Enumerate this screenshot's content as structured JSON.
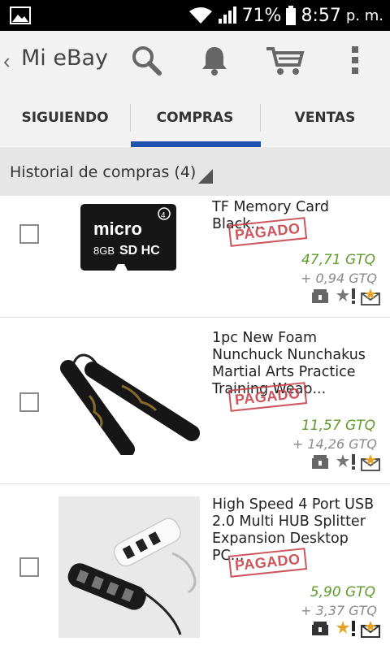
{
  "status_bar": {
    "battery": "71%",
    "time": "8:57",
    "ampm": "p. m."
  },
  "action_bar": {
    "back_chevron": "‹",
    "title": "Mi eBay"
  },
  "tabs": [
    {
      "label": "SIGUIENDO",
      "selected": false
    },
    {
      "label": "COMPRAS",
      "selected": true
    },
    {
      "label": "VENTAS",
      "selected": false
    }
  ],
  "section": {
    "title": "Historial de compras (4)"
  },
  "colors": {
    "accent": "#1f50b0",
    "paid_stamp": "#c8434b",
    "price": "#5f9a2a"
  },
  "items": [
    {
      "title": "TF Memory Card Black...",
      "status": "PAGADO",
      "price": "47,71 GTQ",
      "shipping": "+ 0,94 GTQ",
      "checked": false,
      "product_icon": "micro-sd-card-image",
      "card_text": "micro",
      "card_sub": "SD HC",
      "card_size": "8GB",
      "card_class": "4"
    },
    {
      "title": "1pc New Foam Nunchuck Nunchakus Martial Arts Practice Training Weap...",
      "status": "PAGADO",
      "price": "11,57 GTQ",
      "shipping": "+ 14,26 GTQ",
      "checked": false,
      "product_icon": "nunchaku-image"
    },
    {
      "title": "High Speed 4 Port USB 2.0 Multi HUB Splitter Expansion Desktop PC...",
      "status": "PAGADO",
      "price": "5,90 GTQ",
      "shipping": "+ 3,37 GTQ",
      "checked": false,
      "product_icon": "usb-hub-image"
    }
  ]
}
